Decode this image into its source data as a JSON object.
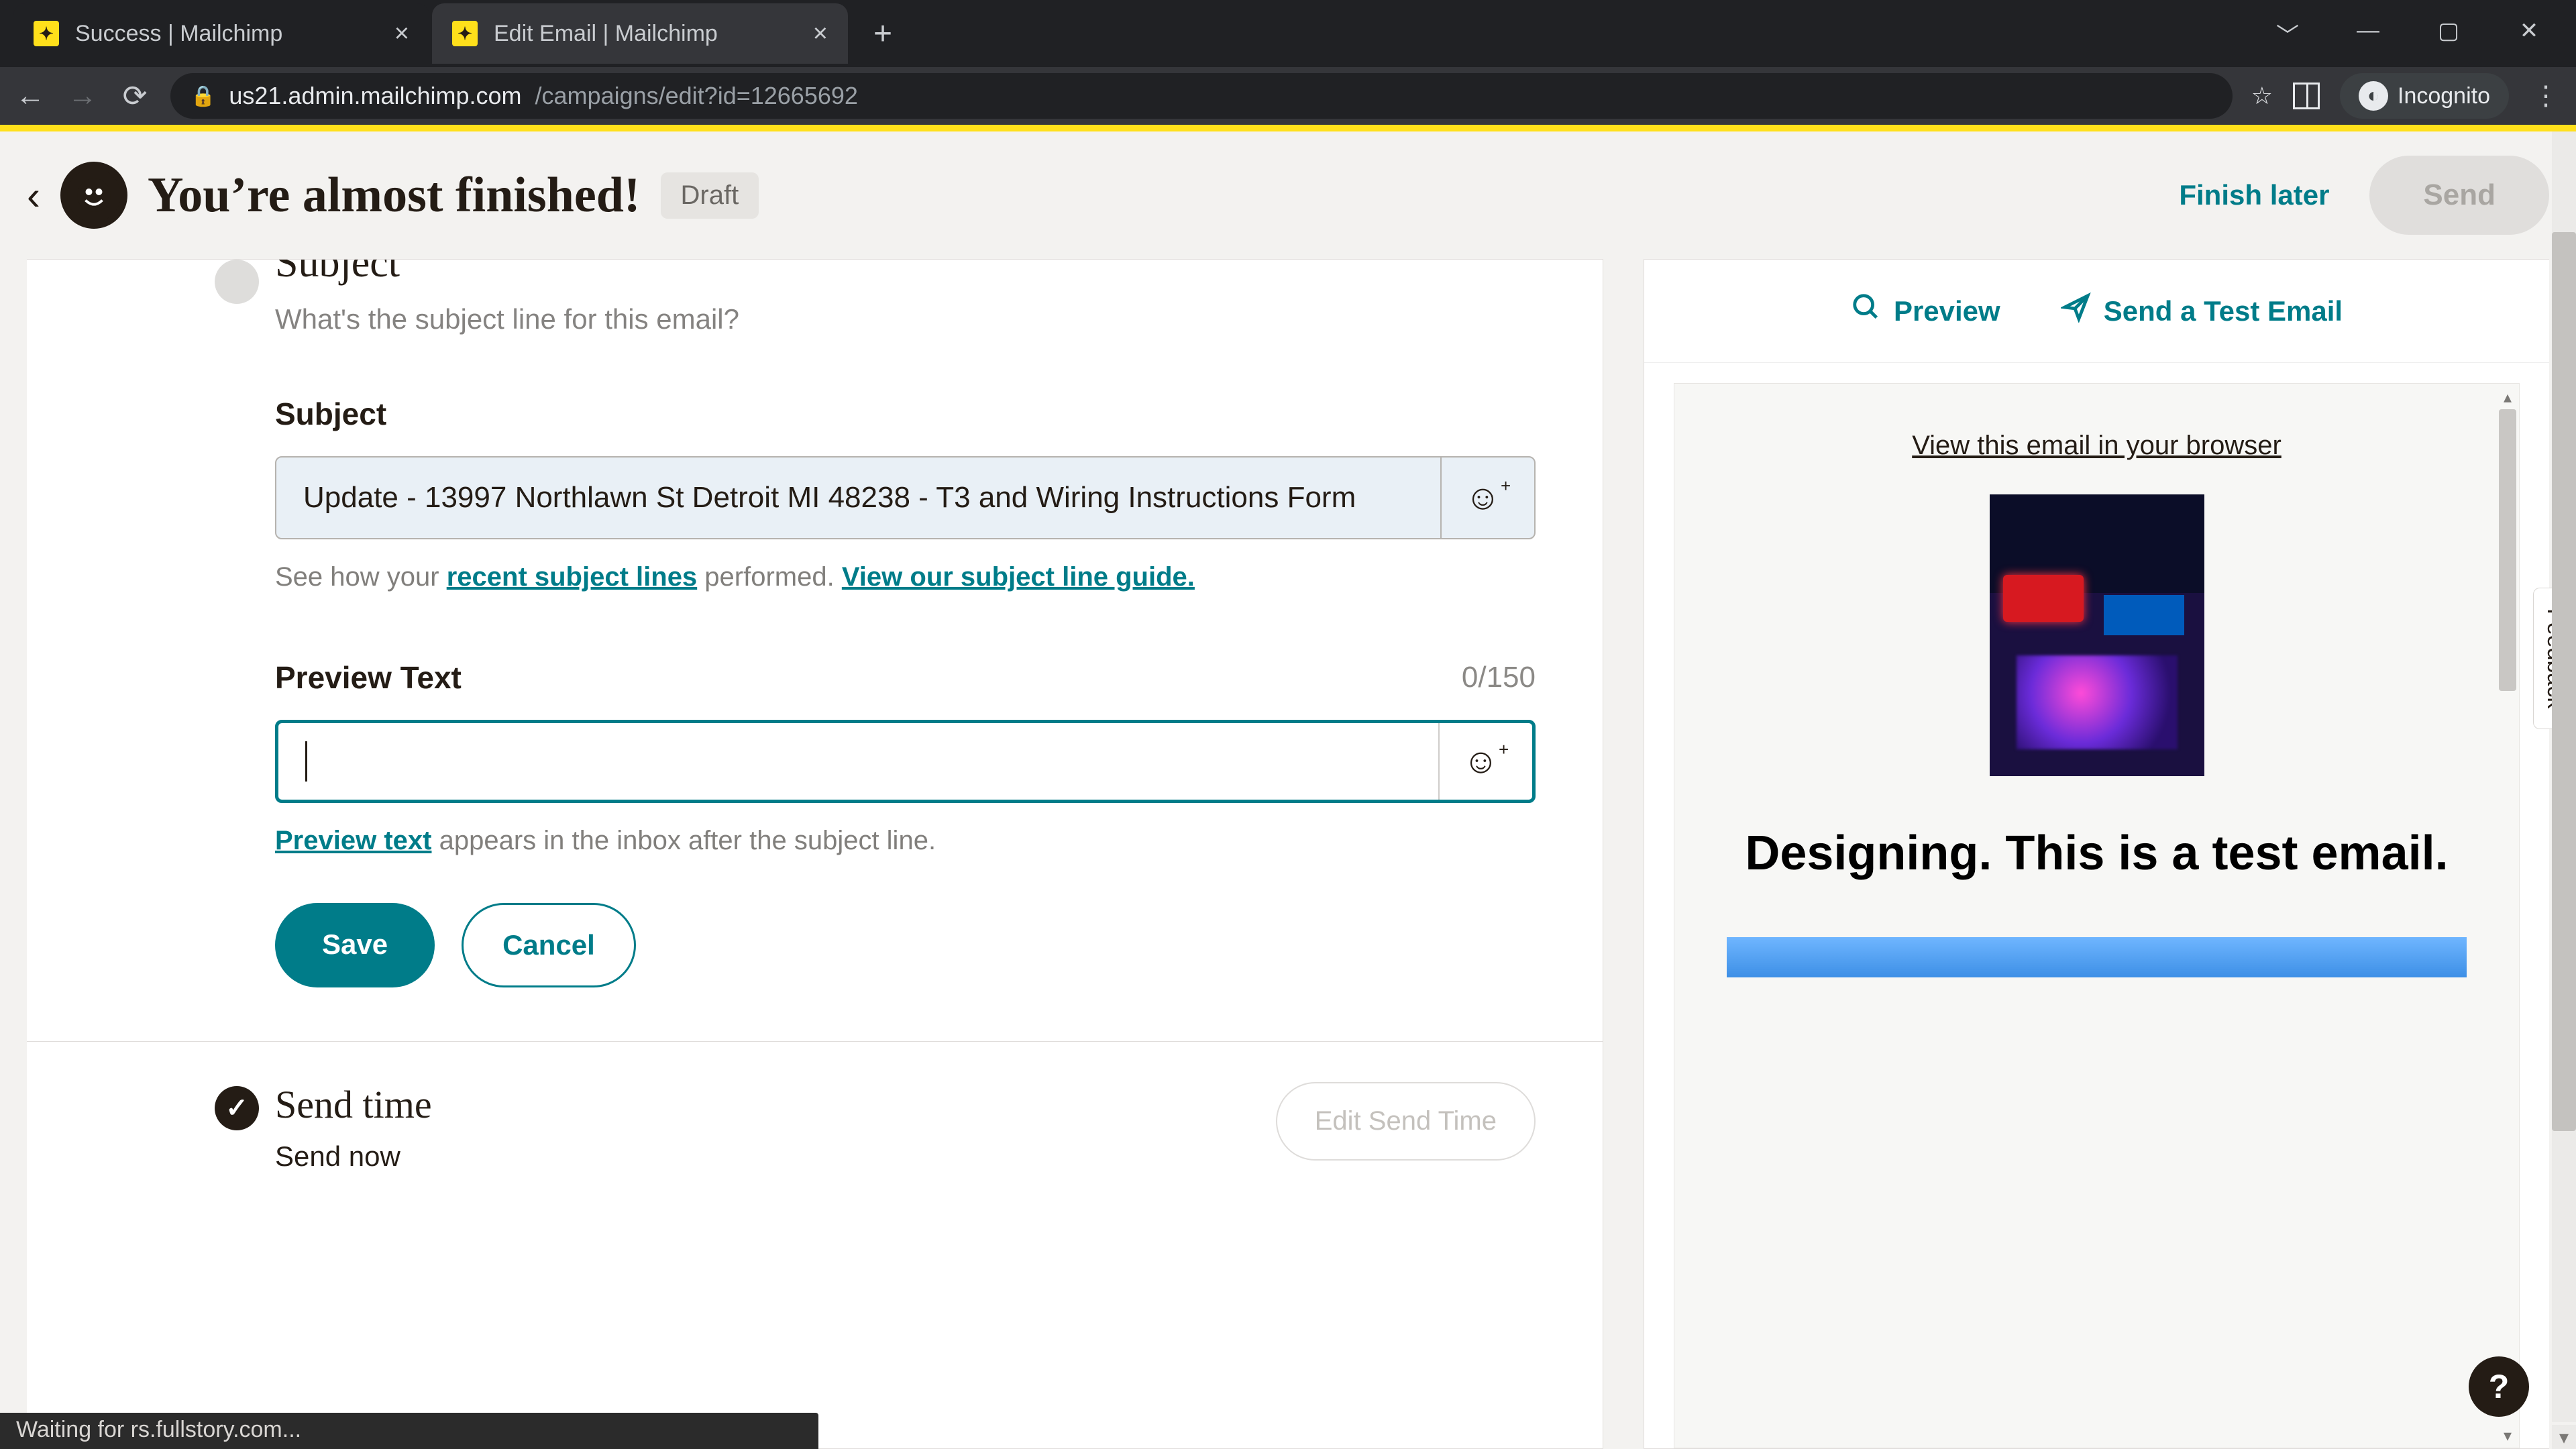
{
  "browser": {
    "tabs": [
      {
        "title": "Success | Mailchimp",
        "active": false
      },
      {
        "title": "Edit Email | Mailchimp",
        "active": true
      }
    ],
    "url_host": "us21.admin.mailchimp.com",
    "url_path": "/campaigns/edit?id=12665692",
    "incognito_label": "Incognito",
    "status_text": "Waiting for rs.fullstory.com..."
  },
  "header": {
    "title": "You’re almost finished!",
    "status_badge": "Draft",
    "finish_later": "Finish later",
    "send": "Send"
  },
  "subject_section": {
    "heading": "Subject",
    "subheading": "What's the subject line for this email?",
    "subject_label": "Subject",
    "subject_value": "Update - 13997 Northlawn St Detroit MI 48238 - T3 and Wiring Instructions Form",
    "help_prefix": "See how your ",
    "help_link1": "recent subject lines",
    "help_mid": " performed. ",
    "help_link2": "View our subject line guide.",
    "preview_label": "Preview Text",
    "preview_counter": "0/150",
    "preview_value": "",
    "preview_help_link": "Preview text",
    "preview_help_rest": " appears in the inbox after the subject line.",
    "save": "Save",
    "cancel": "Cancel"
  },
  "sendtime_section": {
    "heading": "Send time",
    "value": "Send now",
    "edit": "Edit Send Time"
  },
  "right": {
    "preview": "Preview",
    "send_test": "Send a Test Email",
    "view_browser": "View this email in your browser",
    "email_headline": "Designing. This is a test email.",
    "feedback": "Feedback"
  },
  "help_fab": "?"
}
